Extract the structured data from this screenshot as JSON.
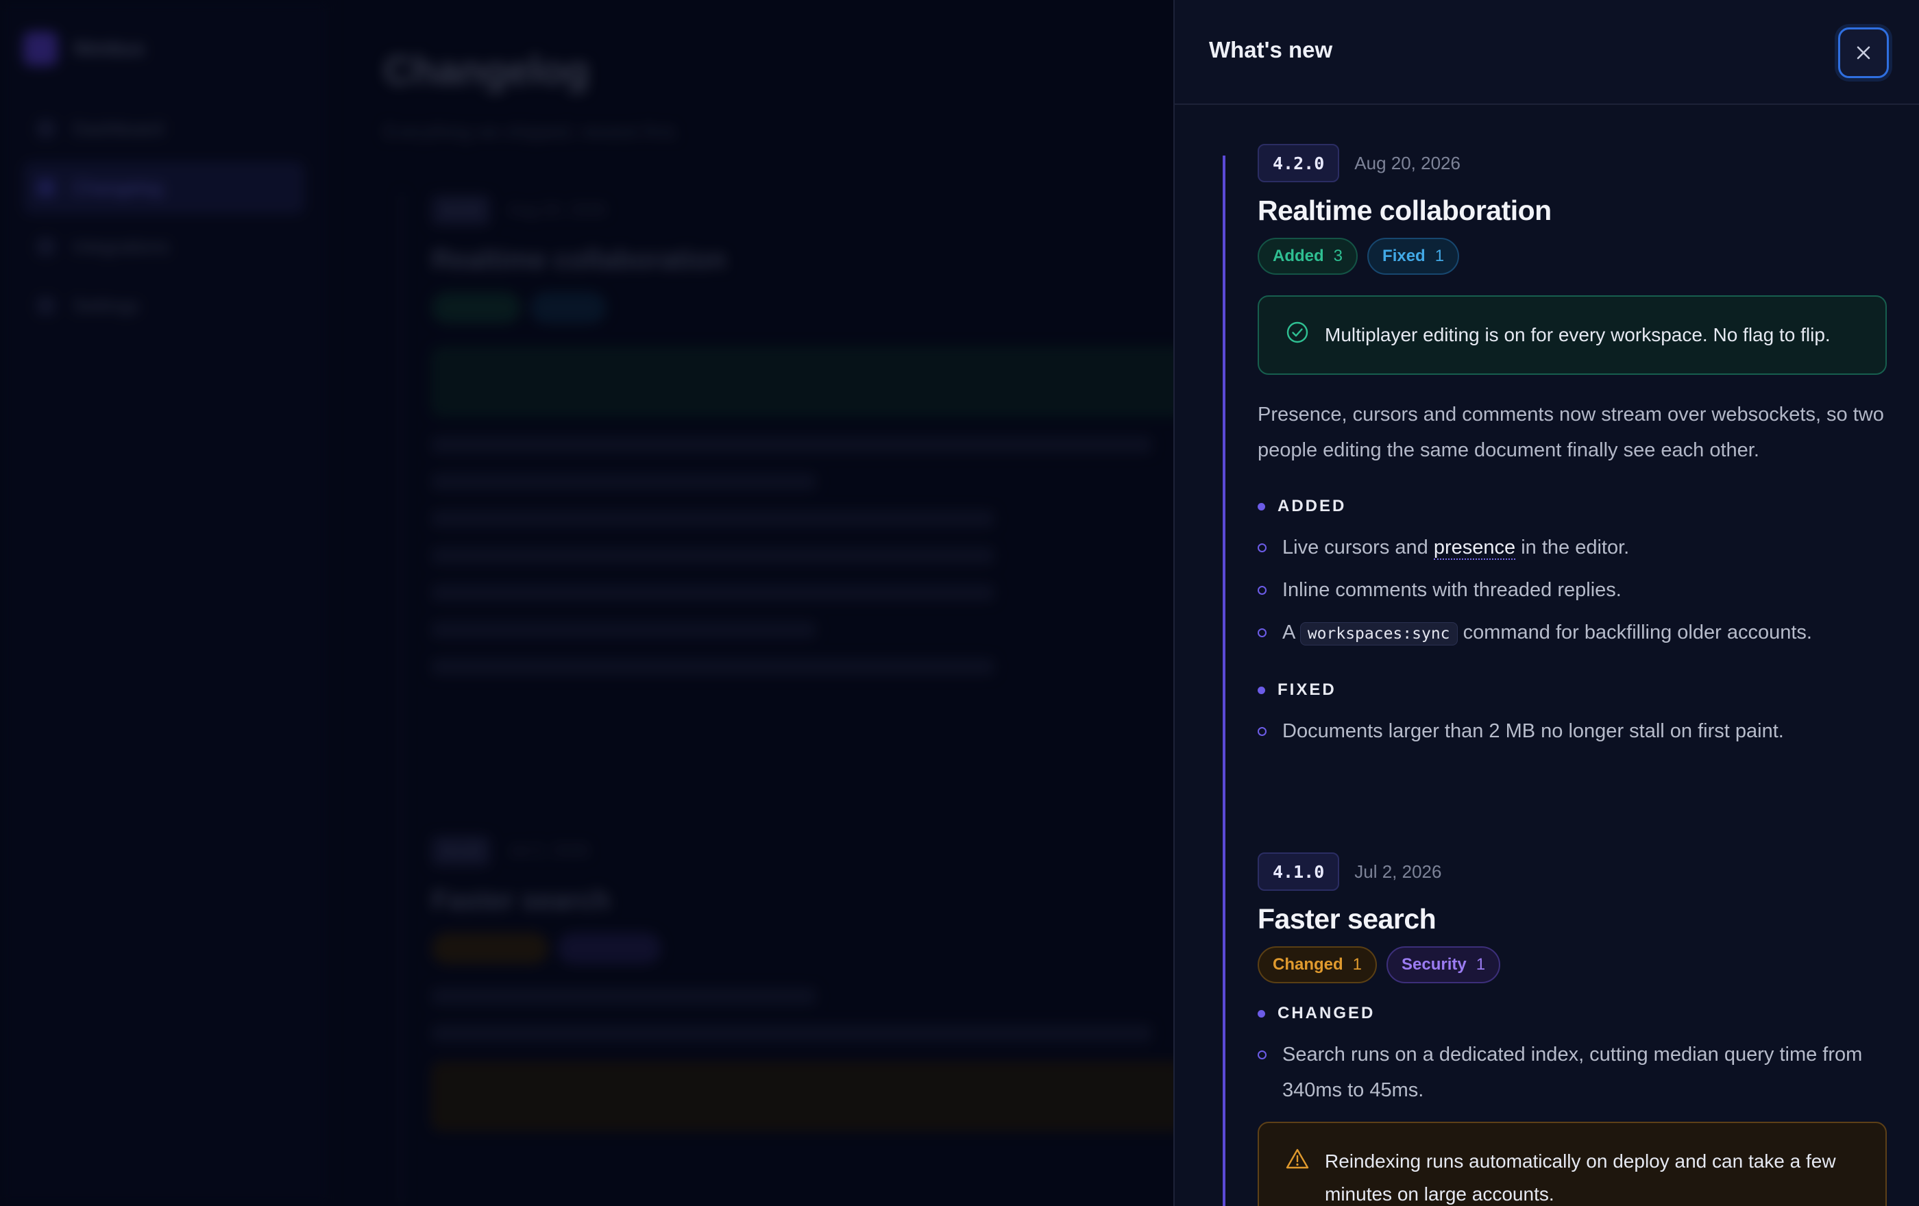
{
  "background": {
    "brand": "Nimbus",
    "nav": [
      {
        "label": "Dashboard",
        "active": false
      },
      {
        "label": "Changelog",
        "active": true
      },
      {
        "label": "Integrations",
        "active": false
      },
      {
        "label": "Settings",
        "active": false
      }
    ],
    "page_title": "Changelog",
    "page_subtitle": "Everything we shipped, newest first."
  },
  "drawer": {
    "title": "What's new",
    "close_icon": "close-icon",
    "accent": "#6c5ce7",
    "entries": [
      {
        "version": "4.2.0",
        "date": "Aug 20, 2026",
        "title": "Realtime collaboration",
        "chips": [
          {
            "label": "Added",
            "count": "3",
            "color": "#2fbf92"
          },
          {
            "label": "Fixed",
            "count": "1",
            "color": "#42a9e6"
          }
        ],
        "callout": {
          "type": "success",
          "icon": "check-circle-icon",
          "text": "Multiplayer editing is on for every workspace. No flag to flip."
        },
        "description": "Presence, cursors and comments now stream over websockets, so two people editing the same document finally see each other.",
        "groups": [
          {
            "label": "ADDED",
            "items": [
              {
                "before": "Live cursors and ",
                "term": "presence",
                "after": " in the editor."
              },
              {
                "text": "Inline comments with threaded replies."
              },
              {
                "before": "A ",
                "code": "workspaces:sync",
                "after": " command for backfilling older accounts."
              }
            ]
          },
          {
            "label": "FIXED",
            "items": [
              {
                "text": "Documents larger than 2 MB no longer stall on first paint."
              }
            ]
          }
        ]
      },
      {
        "version": "4.1.0",
        "date": "Jul 2, 2026",
        "title": "Faster search",
        "chips": [
          {
            "label": "Changed",
            "count": "1",
            "color": "#e09a2e"
          },
          {
            "label": "Security",
            "count": "1",
            "color": "#9b7cf2"
          }
        ],
        "groups": [
          {
            "label": "CHANGED",
            "items": [
              {
                "text": "Search runs on a dedicated index, cutting median query time from 340ms to 45ms."
              }
            ]
          }
        ],
        "callout": {
          "type": "warning",
          "icon": "warning-triangle-icon",
          "text": "Reindexing runs automatically on deploy and can take a few minutes on large accounts."
        }
      }
    ]
  }
}
